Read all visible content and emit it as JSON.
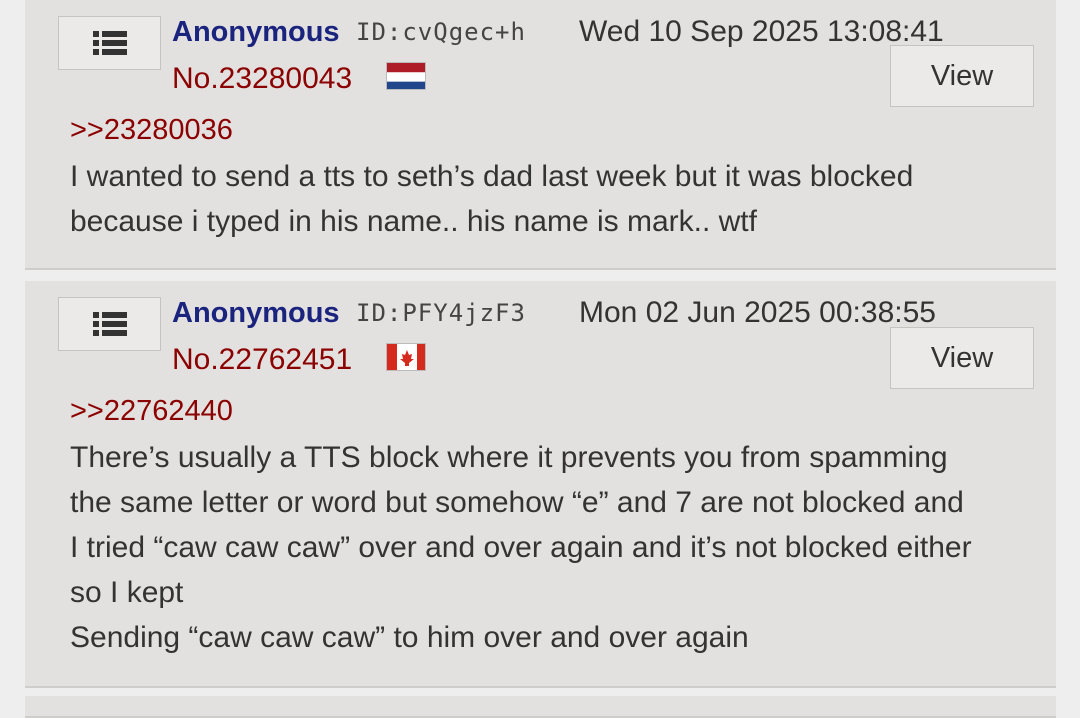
{
  "posts": [
    {
      "name": "Anonymous",
      "id_text": "ID:cvQgec+h",
      "datetime": "Wed 10 Sep 2025 13:08:41",
      "number": "No.23280043",
      "flag": "netherlands-flag",
      "view_label": "View",
      "quote": ">>23280036",
      "lines": [
        "I wanted to send a tts to seth’s dad last week but it was blocked",
        "because i typed in his name.. his name is mark.. wtf"
      ]
    },
    {
      "name": "Anonymous",
      "id_text": "ID:PFY4jzF3",
      "datetime": "Mon 02 Jun 2025 00:38:55",
      "number": "No.22762451",
      "flag": "canada-flag",
      "view_label": "View",
      "quote": ">>22762440",
      "lines": [
        "There’s usually a TTS block where it prevents you from spamming",
        "the same letter or word but somehow “e” and 7 are not blocked and",
        "I tried “caw caw caw” over and over again and it’s not blocked either",
        "so I kept",
        "Sending “caw caw caw” to him over and over again"
      ]
    }
  ],
  "colors": {
    "name": "#1a237e",
    "post_number": "#8b0000",
    "quote": "#8b0000",
    "post_bg": "#e3e1df",
    "page_bg": "#eeeeee"
  }
}
